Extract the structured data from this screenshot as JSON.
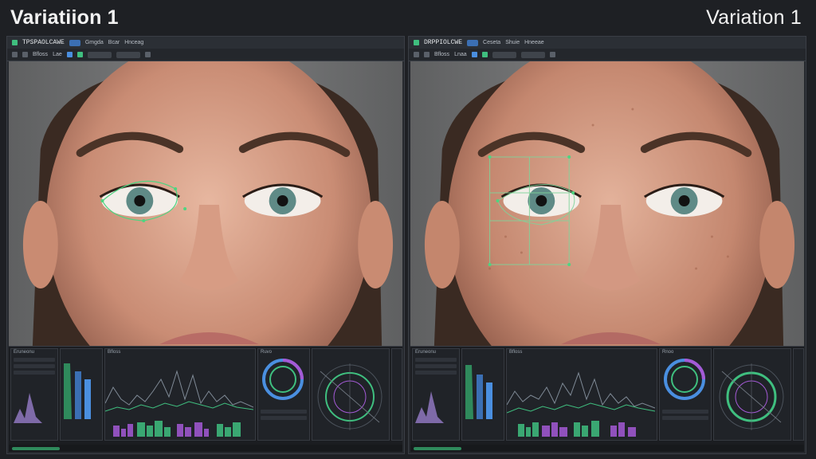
{
  "left_title": "Variatiion 1",
  "right_title": "Variation 1",
  "panels": [
    {
      "app_name": "TPSPAOLCAWE",
      "menu": [
        "Gmgda",
        "Bcar",
        "Hnceag"
      ],
      "toolbar_text": [
        "Bfloss",
        "Lae"
      ],
      "analysis_headers": [
        "Eruneonu",
        "Ruvo"
      ],
      "overlay": "eye-outline"
    },
    {
      "app_name": "DRPPIOLCWE",
      "menu": [
        "Ceseta",
        "Shuie",
        "Hneeae"
      ],
      "toolbar_text": [
        "Bfloss",
        "Lnaa"
      ],
      "analysis_headers": [
        "Eruneonu",
        "Rnoo"
      ],
      "overlay": "eye-grid"
    }
  ],
  "colors": {
    "accent_green": "#3fbf7f",
    "accent_blue": "#4a8fe0",
    "accent_purple": "#a45ad6",
    "window_bg": "#1e2024"
  },
  "icons": [
    "tool-icon",
    "layer-icon",
    "zoom-icon",
    "color-icon"
  ]
}
